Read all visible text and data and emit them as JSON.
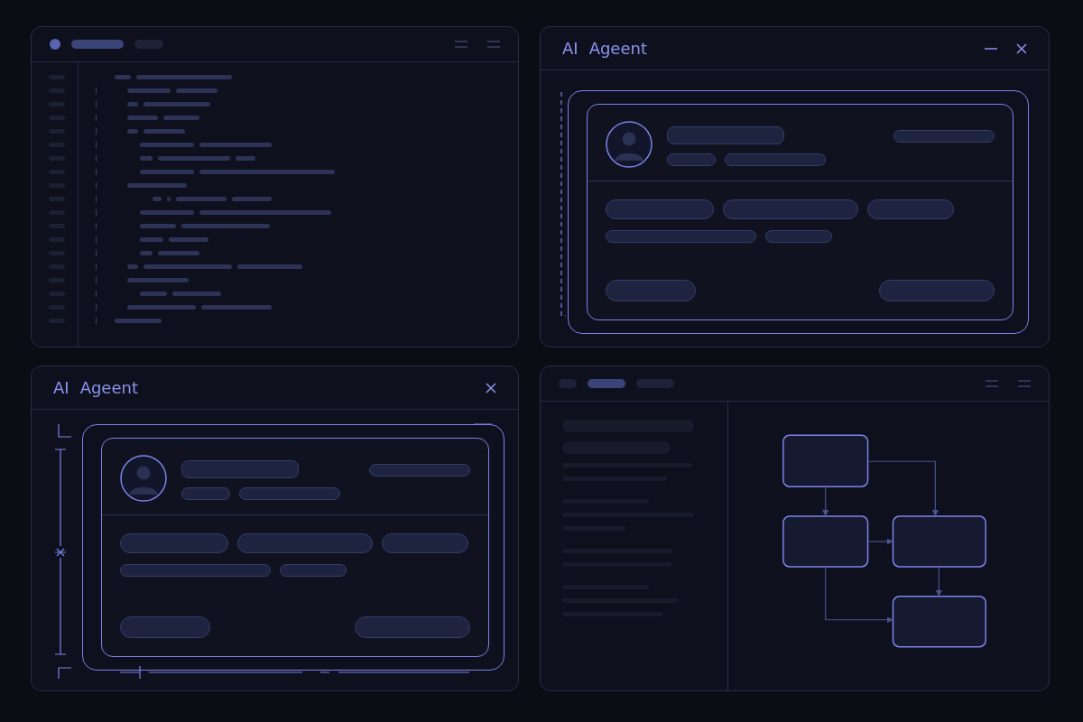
{
  "panels": [
    {
      "kind": "code"
    },
    {
      "kind": "agent",
      "title_parts": [
        "AI",
        "Ageent"
      ],
      "minimize": true,
      "dashed_guide": true,
      "dimension_lines": false
    },
    {
      "kind": "agent",
      "title_parts": [
        "AI",
        "Ageent"
      ],
      "minimize": false,
      "dashed_guide": false,
      "dimension_lines": true
    },
    {
      "kind": "flow"
    }
  ]
}
